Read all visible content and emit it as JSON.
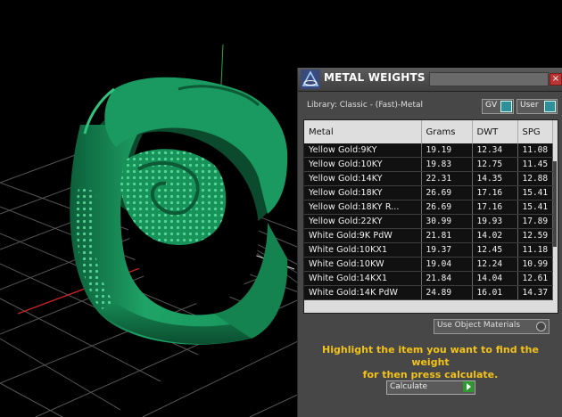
{
  "panel": {
    "title": "METAL WEIGHTS",
    "close_glyph": "×",
    "library_label": "Library: Classic - (Fast)-Metal",
    "gv_label": "GV",
    "user_label": "User",
    "use_materials_label": "Use Object Materials",
    "instruction_line1": "Highlight the item you want to find the weight",
    "instruction_line2": "for then press calculate.",
    "calculate_label": "Calculate"
  },
  "table": {
    "headers": [
      "Metal",
      "Grams",
      "DWT",
      "SPG"
    ],
    "rows": [
      [
        "Yellow Gold:9KY",
        "19.19",
        "12.34",
        "11.08"
      ],
      [
        "Yellow Gold:10KY",
        "19.83",
        "12.75",
        "11.45"
      ],
      [
        "Yellow Gold:14KY",
        "22.31",
        "14.35",
        "12.88"
      ],
      [
        "Yellow Gold:18KY",
        "26.69",
        "17.16",
        "15.41"
      ],
      [
        "Yellow Gold:18KY R...",
        "26.69",
        "17.16",
        "15.41"
      ],
      [
        "Yellow Gold:22KY",
        "30.99",
        "19.93",
        "17.89"
      ],
      [
        "White Gold:9K PdW",
        "21.81",
        "14.02",
        "12.59"
      ],
      [
        "White Gold:10KX1",
        "19.37",
        "12.45",
        "11.18"
      ],
      [
        "White Gold:10KW",
        "19.04",
        "12.24",
        "10.99"
      ],
      [
        "White Gold:14KX1",
        "21.84",
        "14.04",
        "12.61"
      ],
      [
        "White Gold:14K PdW",
        "24.89",
        "16.01",
        "14.37"
      ]
    ]
  },
  "icons": {
    "app": "triangle-logo-icon",
    "close": "close-icon",
    "play": "play-icon"
  },
  "colors": {
    "ring": "#1f9e63",
    "instruction_text": "#f2c21b",
    "grid": "#555555",
    "axis_x": "#cc2222",
    "axis_y": "#3fa04a"
  }
}
